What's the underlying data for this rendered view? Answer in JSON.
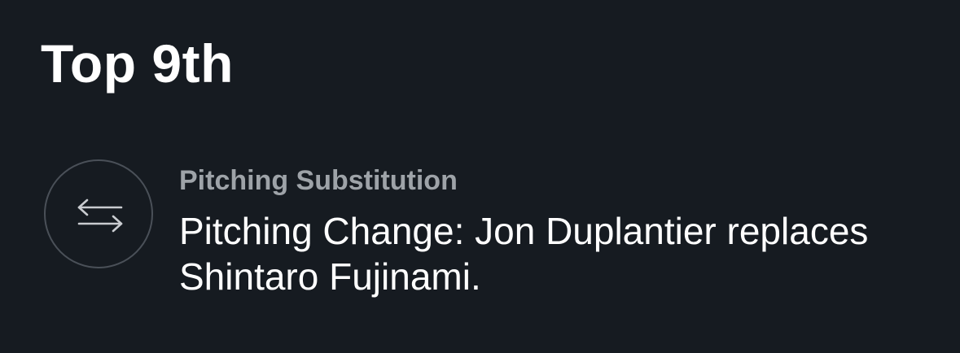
{
  "inning": {
    "label": "Top 9th"
  },
  "event": {
    "icon": "swap-arrows-icon",
    "type": "Pitching Substitution",
    "description": "Pitching Change: Jon Duplantier replaces Shintaro Fujinami."
  },
  "colors": {
    "background": "#161b21",
    "primary_text": "#ffffff",
    "secondary_text": "#9ea3a8",
    "icon_ring": "#4a5058"
  }
}
